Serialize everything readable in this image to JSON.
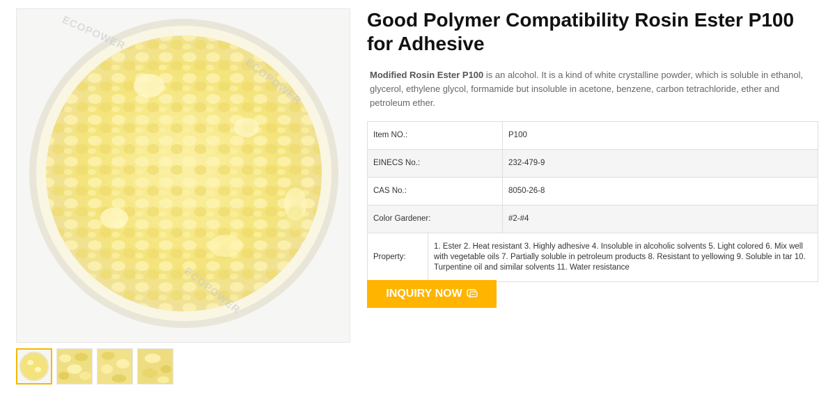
{
  "product": {
    "title": "Good Polymer Compatibility Rosin Ester P100 for Adhesive",
    "description_lead": "Modified Rosin Ester P100",
    "description_body": " is an alcohol. It is a kind of white crystalline powder, which is soluble in ethanol, glycerol, ethylene glycol, formamide but insoluble in acetone, benzene, carbon tetrachloride, ether and petroleum ether."
  },
  "watermark": "ECOPOWER",
  "specs": [
    {
      "label": "Item NO.:",
      "value": "P100"
    },
    {
      "label": "EINECS No.:",
      "value": "232-479-9"
    },
    {
      "label": "CAS No.:",
      "value": "8050-26-8"
    },
    {
      "label": "Color Gardener:",
      "value": "#2-#4"
    },
    {
      "label": "Property:",
      "value": "1. Ester 2. Heat resistant 3. Highly adhesive 4. Insoluble in alcoholic solvents 5. Light colored 6. Mix well with vegetable oils 7. Partially soluble in petroleum products 8. Resistant to yellowing 9. Soluble in tar 10. Turpentine oil and similar solvents 11. Water resistance"
    }
  ],
  "inquiry": {
    "label": "INQUIRY NOW",
    "icon": "chat-icon"
  },
  "thumbnails": [
    {
      "icon": "product-thumbnail",
      "active": true
    },
    {
      "icon": "product-thumbnail",
      "active": false
    },
    {
      "icon": "product-thumbnail",
      "active": false
    },
    {
      "icon": "product-thumbnail",
      "active": false
    }
  ],
  "colors": {
    "accent": "#ffb400",
    "resin": "#f3e27a",
    "thumb_border_active": "#f5b800"
  }
}
